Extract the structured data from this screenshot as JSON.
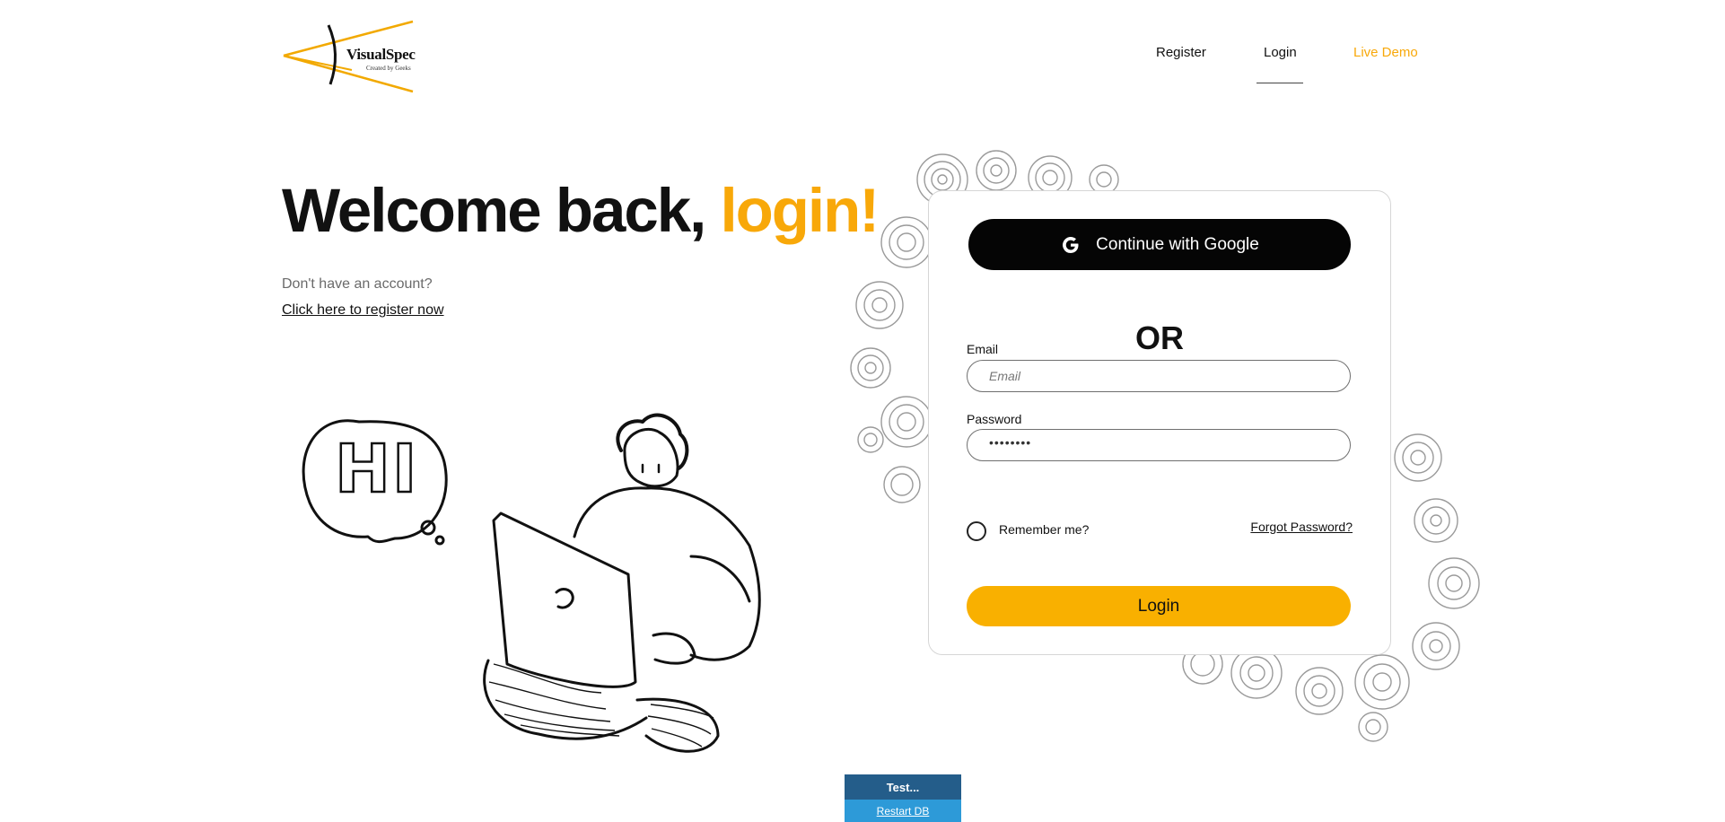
{
  "header": {
    "brand": "VisualSpec",
    "tagline": "Created by Geeks",
    "nav": {
      "register": "Register",
      "login": "Login",
      "live_demo": "Live Demo"
    }
  },
  "hero": {
    "title_main": "Welcome back,",
    "title_accent": "login!",
    "no_account": "Don't have an account?",
    "register_link": "Click here to register now",
    "speech_bubble": "HI"
  },
  "login_card": {
    "google_button": "Continue with Google",
    "or_divider": "OR",
    "email_label": "Email",
    "email_placeholder": "Email",
    "password_label": "Password",
    "password_value": "••••••••",
    "remember_label": "Remember me?",
    "remember_checked": false,
    "forgot_link": "Forgot Password?",
    "login_button": "Login"
  },
  "test_panel": {
    "title": "Test...",
    "restart_link": "Restart DB"
  },
  "colors": {
    "accent": "#f8a809",
    "button_primary": "#f9b000",
    "google_button_bg": "#050505",
    "test_header": "#245d8a",
    "test_link_bg": "#2d9ad8"
  },
  "icons": {
    "logo": "visualspec-logo-icon",
    "google": "google-g-icon"
  }
}
